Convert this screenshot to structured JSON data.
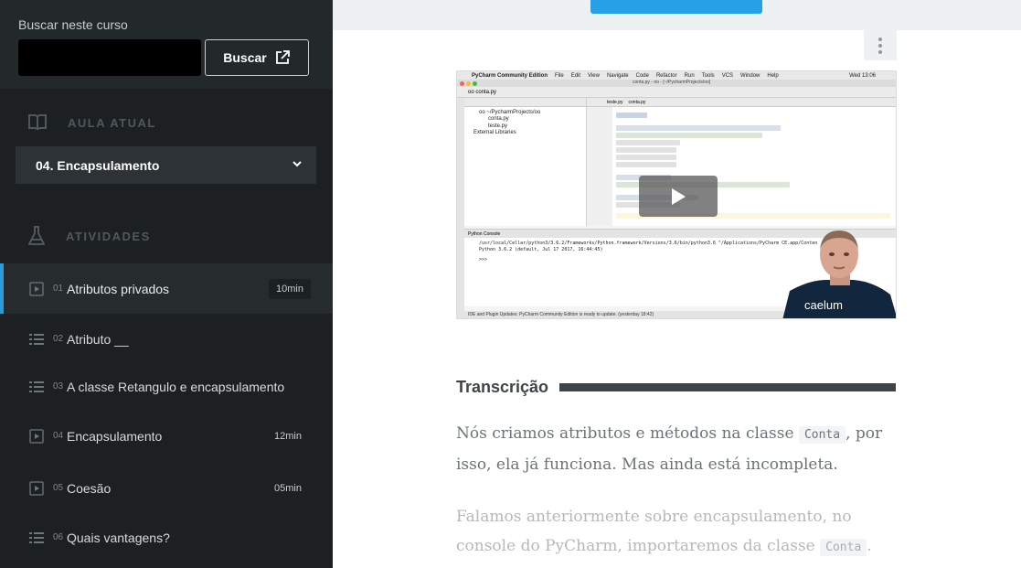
{
  "sidebar": {
    "search": {
      "label": "Buscar neste curso",
      "input_value": "",
      "button_label": "Buscar"
    },
    "current_lesson": {
      "header": "AULA ATUAL",
      "selected": "04. Encapsulamento"
    },
    "activities": {
      "header": "ATIVIDADES",
      "items": [
        {
          "num": "01",
          "title": "Atributos privados",
          "duration": "10min",
          "type": "video",
          "active": true
        },
        {
          "num": "02",
          "title": "Atributo __",
          "duration": "",
          "type": "list",
          "active": false
        },
        {
          "num": "03",
          "title": "A classe Retangulo e encapsulamento",
          "duration": "",
          "type": "list",
          "active": false
        },
        {
          "num": "04",
          "title": "Encapsulamento",
          "duration": "12min",
          "type": "video",
          "active": false
        },
        {
          "num": "05",
          "title": "Coesão",
          "duration": "05min",
          "type": "video",
          "active": false
        },
        {
          "num": "06",
          "title": "Quais vantagens?",
          "duration": "",
          "type": "list",
          "active": false
        }
      ]
    }
  },
  "video": {
    "mac_menu": [
      "PyCharm Community Edition",
      "File",
      "Edit",
      "View",
      "Navigate",
      "Code",
      "Refactor",
      "Run",
      "Tools",
      "VCS",
      "Window",
      "Help"
    ],
    "mac_clock": "Wed 13:06",
    "window_title": "conta.py - oo - [~/PycharmProjects/oo]",
    "breadcrumb": "oo  conta.py",
    "project_items": [
      "oo ~/PycharmProjects/oo",
      "conta.py",
      "teste.py",
      "External Libraries"
    ],
    "editor_tabs": [
      "teste.py",
      "conta.py"
    ],
    "console_title": "Python Console",
    "console_lines": [
      "/usr/local/Cellar/python3/3.6.2/Frameworks/Python.framework/Versions/3.6/bin/python3.6 \"/Applications/PyCharm CE.app/Conten",
      "Python 3.6.2 (default, Jul 17 2017, 16:44:45)",
      ">>>"
    ],
    "status_text": "IDE and Plugin Updates: PyCharm Community Edition is ready to update. (yesterday 18:42)",
    "brand": "caelum"
  },
  "transcript": {
    "title": "Transcrição",
    "p1_before": "Nós criamos atributos e métodos na classe ",
    "p1_code": "Conta",
    "p1_after": ", por isso, ela já funciona. Mas ainda está incompleta.",
    "p2_before": "Falamos anteriormente sobre encapsulamento, no console do PyCharm, importaremos da classe ",
    "p2_code": "Conta",
    "p2_after": "."
  },
  "colors": {
    "sidebar_bg": "#1c2022",
    "accent": "#2e9bd6",
    "top_button": "#27a0e6"
  }
}
